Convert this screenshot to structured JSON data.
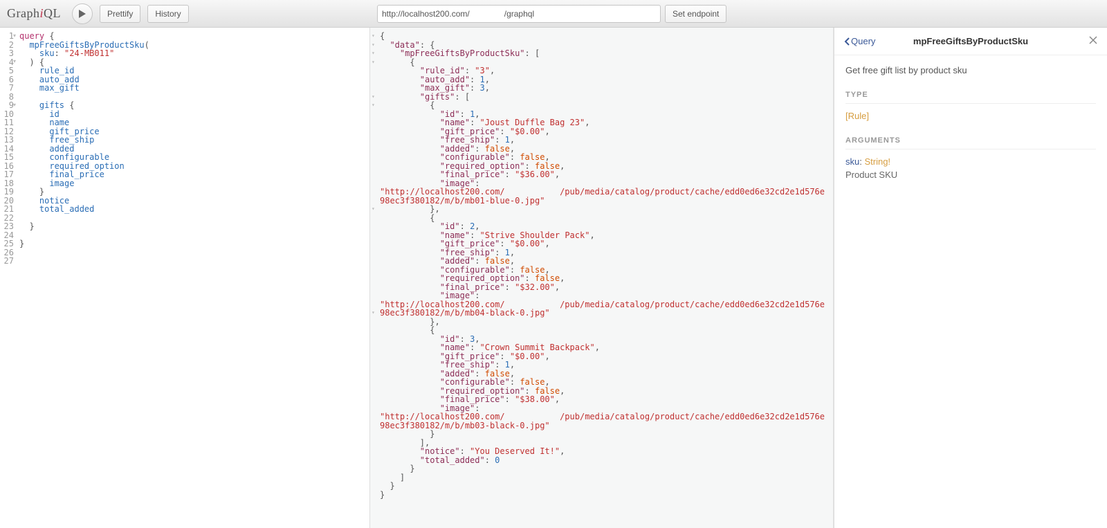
{
  "toolbar": {
    "logo_prefix": "Graph",
    "logo_italic": "i",
    "logo_suffix": "QL",
    "prettify": "Prettify",
    "history": "History",
    "endpoint_value": "http://localhost200.com/               /graphql",
    "set_endpoint": "Set endpoint"
  },
  "editor": {
    "lines": [
      {
        "n": "1",
        "fold": true,
        "tokens": [
          {
            "c": "kw",
            "t": "query"
          },
          {
            "c": "punct",
            "t": " {"
          }
        ]
      },
      {
        "n": "2",
        "tokens": [
          {
            "c": "punct",
            "t": "  "
          },
          {
            "c": "def",
            "t": "mpFreeGiftsByProductSku"
          },
          {
            "c": "punct",
            "t": "("
          }
        ]
      },
      {
        "n": "3",
        "tokens": [
          {
            "c": "punct",
            "t": "    "
          },
          {
            "c": "attr",
            "t": "sku"
          },
          {
            "c": "punct",
            "t": ": "
          },
          {
            "c": "str",
            "t": "\"24-MB011\""
          }
        ]
      },
      {
        "n": "4",
        "fold": true,
        "tokens": [
          {
            "c": "punct",
            "t": "  ) {"
          }
        ]
      },
      {
        "n": "5",
        "tokens": [
          {
            "c": "punct",
            "t": "    "
          },
          {
            "c": "attr",
            "t": "rule_id"
          }
        ]
      },
      {
        "n": "6",
        "tokens": [
          {
            "c": "punct",
            "t": "    "
          },
          {
            "c": "attr",
            "t": "auto_add"
          }
        ]
      },
      {
        "n": "7",
        "tokens": [
          {
            "c": "punct",
            "t": "    "
          },
          {
            "c": "attr",
            "t": "max_gift"
          }
        ]
      },
      {
        "n": "8",
        "tokens": [
          {
            "c": "punct",
            "t": ""
          }
        ]
      },
      {
        "n": "9",
        "fold": true,
        "tokens": [
          {
            "c": "punct",
            "t": "    "
          },
          {
            "c": "attr",
            "t": "gifts"
          },
          {
            "c": "punct",
            "t": " {"
          }
        ]
      },
      {
        "n": "10",
        "tokens": [
          {
            "c": "punct",
            "t": "      "
          },
          {
            "c": "attr",
            "t": "id"
          }
        ]
      },
      {
        "n": "11",
        "tokens": [
          {
            "c": "punct",
            "t": "      "
          },
          {
            "c": "attr",
            "t": "name"
          }
        ]
      },
      {
        "n": "12",
        "tokens": [
          {
            "c": "punct",
            "t": "      "
          },
          {
            "c": "attr",
            "t": "gift_price"
          }
        ]
      },
      {
        "n": "13",
        "tokens": [
          {
            "c": "punct",
            "t": "      "
          },
          {
            "c": "attr",
            "t": "free_ship"
          }
        ]
      },
      {
        "n": "14",
        "tokens": [
          {
            "c": "punct",
            "t": "      "
          },
          {
            "c": "attr",
            "t": "added"
          }
        ]
      },
      {
        "n": "15",
        "tokens": [
          {
            "c": "punct",
            "t": "      "
          },
          {
            "c": "attr",
            "t": "configurable"
          }
        ]
      },
      {
        "n": "16",
        "tokens": [
          {
            "c": "punct",
            "t": "      "
          },
          {
            "c": "attr",
            "t": "required_option"
          }
        ]
      },
      {
        "n": "17",
        "tokens": [
          {
            "c": "punct",
            "t": "      "
          },
          {
            "c": "attr",
            "t": "final_price"
          }
        ]
      },
      {
        "n": "18",
        "tokens": [
          {
            "c": "punct",
            "t": "      "
          },
          {
            "c": "attr",
            "t": "image"
          }
        ]
      },
      {
        "n": "19",
        "tokens": [
          {
            "c": "punct",
            "t": "    }"
          }
        ]
      },
      {
        "n": "20",
        "tokens": [
          {
            "c": "punct",
            "t": "    "
          },
          {
            "c": "attr",
            "t": "notice"
          }
        ]
      },
      {
        "n": "21",
        "tokens": [
          {
            "c": "punct",
            "t": "    "
          },
          {
            "c": "attr",
            "t": "total_added"
          }
        ]
      },
      {
        "n": "22",
        "tokens": [
          {
            "c": "punct",
            "t": ""
          }
        ]
      },
      {
        "n": "23",
        "tokens": [
          {
            "c": "punct",
            "t": "  }"
          }
        ]
      },
      {
        "n": "24",
        "tokens": [
          {
            "c": "punct",
            "t": ""
          }
        ]
      },
      {
        "n": "25",
        "tokens": [
          {
            "c": "punct",
            "t": "}"
          }
        ]
      },
      {
        "n": "26",
        "tokens": [
          {
            "c": "punct",
            "t": ""
          }
        ]
      },
      {
        "n": "27",
        "tokens": [
          {
            "c": "punct",
            "t": ""
          }
        ]
      }
    ]
  },
  "result": {
    "json_tokens": [
      [
        {
          "c": "punct",
          "t": "{"
        }
      ],
      [
        {
          "c": "punct",
          "t": "  "
        },
        {
          "c": "rkey",
          "t": "\"data\""
        },
        {
          "c": "punct",
          "t": ": {"
        }
      ],
      [
        {
          "c": "punct",
          "t": "    "
        },
        {
          "c": "rkey",
          "t": "\"mpFreeGiftsByProductSku\""
        },
        {
          "c": "punct",
          "t": ": ["
        }
      ],
      [
        {
          "c": "punct",
          "t": "      {"
        }
      ],
      [
        {
          "c": "punct",
          "t": "        "
        },
        {
          "c": "rkey",
          "t": "\"rule_id\""
        },
        {
          "c": "punct",
          "t": ": "
        },
        {
          "c": "rstr",
          "t": "\"3\""
        },
        {
          "c": "punct",
          "t": ","
        }
      ],
      [
        {
          "c": "punct",
          "t": "        "
        },
        {
          "c": "rkey",
          "t": "\"auto_add\""
        },
        {
          "c": "punct",
          "t": ": "
        },
        {
          "c": "rnum",
          "t": "1"
        },
        {
          "c": "punct",
          "t": ","
        }
      ],
      [
        {
          "c": "punct",
          "t": "        "
        },
        {
          "c": "rkey",
          "t": "\"max_gift\""
        },
        {
          "c": "punct",
          "t": ": "
        },
        {
          "c": "rnum",
          "t": "3"
        },
        {
          "c": "punct",
          "t": ","
        }
      ],
      [
        {
          "c": "punct",
          "t": "        "
        },
        {
          "c": "rkey",
          "t": "\"gifts\""
        },
        {
          "c": "punct",
          "t": ": ["
        }
      ],
      [
        {
          "c": "punct",
          "t": "          {"
        }
      ],
      [
        {
          "c": "punct",
          "t": "            "
        },
        {
          "c": "rkey",
          "t": "\"id\""
        },
        {
          "c": "punct",
          "t": ": "
        },
        {
          "c": "rnum",
          "t": "1"
        },
        {
          "c": "punct",
          "t": ","
        }
      ],
      [
        {
          "c": "punct",
          "t": "            "
        },
        {
          "c": "rkey",
          "t": "\"name\""
        },
        {
          "c": "punct",
          "t": ": "
        },
        {
          "c": "rstr",
          "t": "\"Joust Duffle Bag 23\""
        },
        {
          "c": "punct",
          "t": ","
        }
      ],
      [
        {
          "c": "punct",
          "t": "            "
        },
        {
          "c": "rkey",
          "t": "\"gift_price\""
        },
        {
          "c": "punct",
          "t": ": "
        },
        {
          "c": "rstr",
          "t": "\"$0.00\""
        },
        {
          "c": "punct",
          "t": ","
        }
      ],
      [
        {
          "c": "punct",
          "t": "            "
        },
        {
          "c": "rkey",
          "t": "\"free_ship\""
        },
        {
          "c": "punct",
          "t": ": "
        },
        {
          "c": "rnum",
          "t": "1"
        },
        {
          "c": "punct",
          "t": ","
        }
      ],
      [
        {
          "c": "punct",
          "t": "            "
        },
        {
          "c": "rkey",
          "t": "\"added\""
        },
        {
          "c": "punct",
          "t": ": "
        },
        {
          "c": "rbool",
          "t": "false"
        },
        {
          "c": "punct",
          "t": ","
        }
      ],
      [
        {
          "c": "punct",
          "t": "            "
        },
        {
          "c": "rkey",
          "t": "\"configurable\""
        },
        {
          "c": "punct",
          "t": ": "
        },
        {
          "c": "rbool",
          "t": "false"
        },
        {
          "c": "punct",
          "t": ","
        }
      ],
      [
        {
          "c": "punct",
          "t": "            "
        },
        {
          "c": "rkey",
          "t": "\"required_option\""
        },
        {
          "c": "punct",
          "t": ": "
        },
        {
          "c": "rbool",
          "t": "false"
        },
        {
          "c": "punct",
          "t": ","
        }
      ],
      [
        {
          "c": "punct",
          "t": "            "
        },
        {
          "c": "rkey",
          "t": "\"final_price\""
        },
        {
          "c": "punct",
          "t": ": "
        },
        {
          "c": "rstr",
          "t": "\"$36.00\""
        },
        {
          "c": "punct",
          "t": ","
        }
      ],
      [
        {
          "c": "punct",
          "t": "            "
        },
        {
          "c": "rkey",
          "t": "\"image\""
        },
        {
          "c": "punct",
          "t": ": "
        }
      ],
      [
        {
          "c": "rstr",
          "t": "\"http://localhost200.com/           /pub/media/catalog/product/cache/edd0ed6e32cd2e1d576e98ec3f380182/m/b/mb01-blue-0.jpg\""
        }
      ],
      [
        {
          "c": "punct",
          "t": "          },"
        }
      ],
      [
        {
          "c": "punct",
          "t": "          {"
        }
      ],
      [
        {
          "c": "punct",
          "t": "            "
        },
        {
          "c": "rkey",
          "t": "\"id\""
        },
        {
          "c": "punct",
          "t": ": "
        },
        {
          "c": "rnum",
          "t": "2"
        },
        {
          "c": "punct",
          "t": ","
        }
      ],
      [
        {
          "c": "punct",
          "t": "            "
        },
        {
          "c": "rkey",
          "t": "\"name\""
        },
        {
          "c": "punct",
          "t": ": "
        },
        {
          "c": "rstr",
          "t": "\"Strive Shoulder Pack\""
        },
        {
          "c": "punct",
          "t": ","
        }
      ],
      [
        {
          "c": "punct",
          "t": "            "
        },
        {
          "c": "rkey",
          "t": "\"gift_price\""
        },
        {
          "c": "punct",
          "t": ": "
        },
        {
          "c": "rstr",
          "t": "\"$0.00\""
        },
        {
          "c": "punct",
          "t": ","
        }
      ],
      [
        {
          "c": "punct",
          "t": "            "
        },
        {
          "c": "rkey",
          "t": "\"free_ship\""
        },
        {
          "c": "punct",
          "t": ": "
        },
        {
          "c": "rnum",
          "t": "1"
        },
        {
          "c": "punct",
          "t": ","
        }
      ],
      [
        {
          "c": "punct",
          "t": "            "
        },
        {
          "c": "rkey",
          "t": "\"added\""
        },
        {
          "c": "punct",
          "t": ": "
        },
        {
          "c": "rbool",
          "t": "false"
        },
        {
          "c": "punct",
          "t": ","
        }
      ],
      [
        {
          "c": "punct",
          "t": "            "
        },
        {
          "c": "rkey",
          "t": "\"configurable\""
        },
        {
          "c": "punct",
          "t": ": "
        },
        {
          "c": "rbool",
          "t": "false"
        },
        {
          "c": "punct",
          "t": ","
        }
      ],
      [
        {
          "c": "punct",
          "t": "            "
        },
        {
          "c": "rkey",
          "t": "\"required_option\""
        },
        {
          "c": "punct",
          "t": ": "
        },
        {
          "c": "rbool",
          "t": "false"
        },
        {
          "c": "punct",
          "t": ","
        }
      ],
      [
        {
          "c": "punct",
          "t": "            "
        },
        {
          "c": "rkey",
          "t": "\"final_price\""
        },
        {
          "c": "punct",
          "t": ": "
        },
        {
          "c": "rstr",
          "t": "\"$32.00\""
        },
        {
          "c": "punct",
          "t": ","
        }
      ],
      [
        {
          "c": "punct",
          "t": "            "
        },
        {
          "c": "rkey",
          "t": "\"image\""
        },
        {
          "c": "punct",
          "t": ": "
        }
      ],
      [
        {
          "c": "rstr",
          "t": "\"http://localhost200.com/           /pub/media/catalog/product/cache/edd0ed6e32cd2e1d576e98ec3f380182/m/b/mb04-black-0.jpg\""
        }
      ],
      [
        {
          "c": "punct",
          "t": "          },"
        }
      ],
      [
        {
          "c": "punct",
          "t": "          {"
        }
      ],
      [
        {
          "c": "punct",
          "t": "            "
        },
        {
          "c": "rkey",
          "t": "\"id\""
        },
        {
          "c": "punct",
          "t": ": "
        },
        {
          "c": "rnum",
          "t": "3"
        },
        {
          "c": "punct",
          "t": ","
        }
      ],
      [
        {
          "c": "punct",
          "t": "            "
        },
        {
          "c": "rkey",
          "t": "\"name\""
        },
        {
          "c": "punct",
          "t": ": "
        },
        {
          "c": "rstr",
          "t": "\"Crown Summit Backpack\""
        },
        {
          "c": "punct",
          "t": ","
        }
      ],
      [
        {
          "c": "punct",
          "t": "            "
        },
        {
          "c": "rkey",
          "t": "\"gift_price\""
        },
        {
          "c": "punct",
          "t": ": "
        },
        {
          "c": "rstr",
          "t": "\"$0.00\""
        },
        {
          "c": "punct",
          "t": ","
        }
      ],
      [
        {
          "c": "punct",
          "t": "            "
        },
        {
          "c": "rkey",
          "t": "\"free_ship\""
        },
        {
          "c": "punct",
          "t": ": "
        },
        {
          "c": "rnum",
          "t": "1"
        },
        {
          "c": "punct",
          "t": ","
        }
      ],
      [
        {
          "c": "punct",
          "t": "            "
        },
        {
          "c": "rkey",
          "t": "\"added\""
        },
        {
          "c": "punct",
          "t": ": "
        },
        {
          "c": "rbool",
          "t": "false"
        },
        {
          "c": "punct",
          "t": ","
        }
      ],
      [
        {
          "c": "punct",
          "t": "            "
        },
        {
          "c": "rkey",
          "t": "\"configurable\""
        },
        {
          "c": "punct",
          "t": ": "
        },
        {
          "c": "rbool",
          "t": "false"
        },
        {
          "c": "punct",
          "t": ","
        }
      ],
      [
        {
          "c": "punct",
          "t": "            "
        },
        {
          "c": "rkey",
          "t": "\"required_option\""
        },
        {
          "c": "punct",
          "t": ": "
        },
        {
          "c": "rbool",
          "t": "false"
        },
        {
          "c": "punct",
          "t": ","
        }
      ],
      [
        {
          "c": "punct",
          "t": "            "
        },
        {
          "c": "rkey",
          "t": "\"final_price\""
        },
        {
          "c": "punct",
          "t": ": "
        },
        {
          "c": "rstr",
          "t": "\"$38.00\""
        },
        {
          "c": "punct",
          "t": ","
        }
      ],
      [
        {
          "c": "punct",
          "t": "            "
        },
        {
          "c": "rkey",
          "t": "\"image\""
        },
        {
          "c": "punct",
          "t": ": "
        }
      ],
      [
        {
          "c": "rstr",
          "t": "\"http://localhost200.com/           /pub/media/catalog/product/cache/edd0ed6e32cd2e1d576e98ec3f380182/m/b/mb03-black-0.jpg\""
        }
      ],
      [
        {
          "c": "punct",
          "t": "          }"
        }
      ],
      [
        {
          "c": "punct",
          "t": "        ],"
        }
      ],
      [
        {
          "c": "punct",
          "t": "        "
        },
        {
          "c": "rkey",
          "t": "\"notice\""
        },
        {
          "c": "punct",
          "t": ": "
        },
        {
          "c": "rstr",
          "t": "\"You Deserved It!\""
        },
        {
          "c": "punct",
          "t": ","
        }
      ],
      [
        {
          "c": "punct",
          "t": "        "
        },
        {
          "c": "rkey",
          "t": "\"total_added\""
        },
        {
          "c": "punct",
          "t": ": "
        },
        {
          "c": "rnum",
          "t": "0"
        }
      ],
      [
        {
          "c": "punct",
          "t": "      }"
        }
      ],
      [
        {
          "c": "punct",
          "t": "    ]"
        }
      ],
      [
        {
          "c": "punct",
          "t": "  }"
        }
      ],
      [
        {
          "c": "punct",
          "t": "}"
        }
      ]
    ]
  },
  "doc": {
    "back_label": "Query",
    "title": "mpFreeGiftsByProductSku",
    "description": "Get free gift list by product sku",
    "section_type": "TYPE",
    "type_value": "[Rule]",
    "section_args": "ARGUMENTS",
    "arg_name": "sku",
    "arg_sep": ": ",
    "arg_type": "String!",
    "arg_desc": "Product SKU"
  }
}
